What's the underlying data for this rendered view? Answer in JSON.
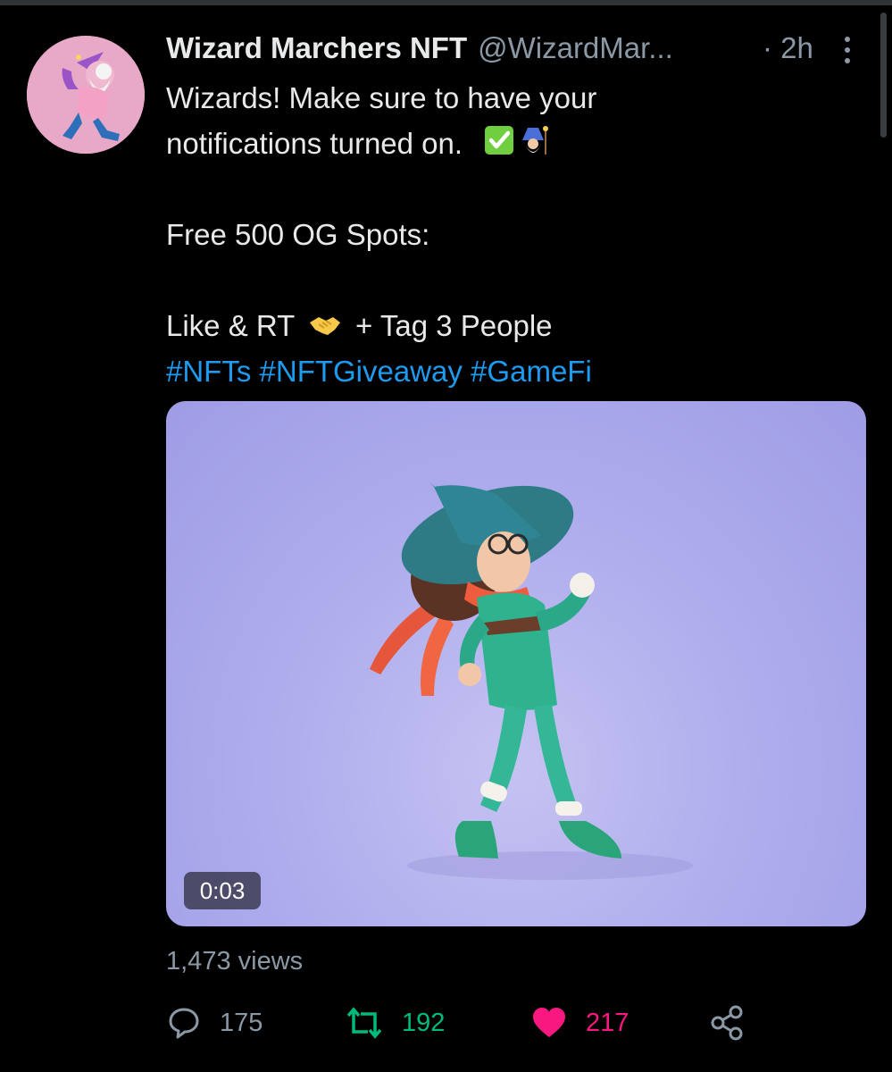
{
  "tweet": {
    "display_name": "Wizard Marchers NFT",
    "handle": "@WizardMar...",
    "time": "· 2h",
    "lines": [
      "Wizards! Make sure to have your",
      "notifications turned on."
    ],
    "spots_line": "Free 500 OG Spots:",
    "like_rt_prefix": "Like & RT",
    "like_rt_suffix": "+ Tag 3 People",
    "hashtags": [
      "#NFTs",
      "#NFTGiveaway",
      "#GameFi"
    ]
  },
  "media": {
    "duration": "0:03"
  },
  "stats": {
    "views": "1,473 views",
    "replies": "175",
    "retweets": "192",
    "likes": "217"
  },
  "icons": {
    "reply": "speech-bubble-icon",
    "retweet": "retweet-arrows-icon",
    "like": "heart-icon",
    "share": "share-icon"
  },
  "colors": {
    "background": "#000000",
    "text": "#e7e9ea",
    "muted": "#8b98a5",
    "link": "#1d9bf0",
    "retweet": "#00ba7c",
    "like": "#f91880",
    "media_bg": "#b0aeed"
  }
}
